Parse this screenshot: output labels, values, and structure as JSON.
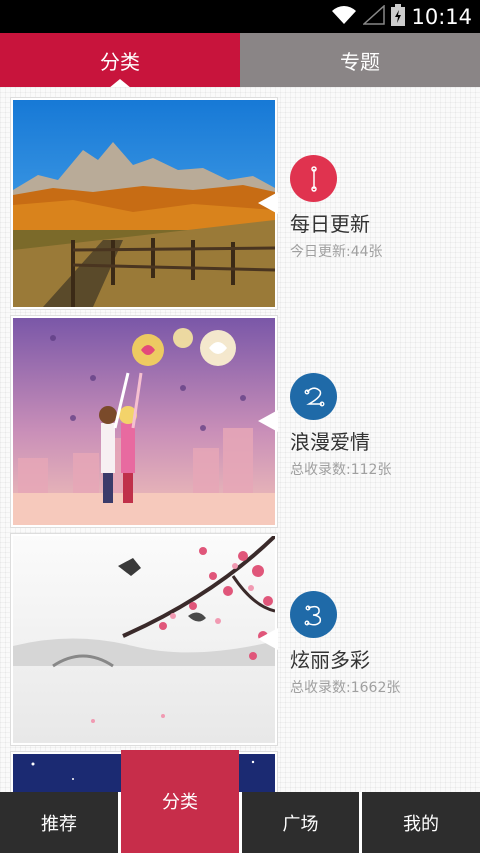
{
  "status_bar": {
    "time": "10:14"
  },
  "top_tabs": [
    {
      "label": "分类",
      "active": true
    },
    {
      "label": "专题",
      "active": false
    }
  ],
  "categories": [
    {
      "number": "1",
      "title": "每日更新",
      "subtitle": "今日更新:44张",
      "badge_color": "#e0334f"
    },
    {
      "number": "2",
      "title": "浪漫爱情",
      "subtitle": "总收录数:112张",
      "badge_color": "#1f6aa8"
    },
    {
      "number": "3",
      "title": "炫丽多彩",
      "subtitle": "总收录数:1662张",
      "badge_color": "#1f6aa8"
    }
  ],
  "bottom_nav": {
    "items": [
      {
        "label": "推荐"
      },
      {
        "label": "分类",
        "active": true
      },
      {
        "label": "广场"
      },
      {
        "label": "我的"
      }
    ]
  },
  "colors": {
    "accent": "#c8143c",
    "inactive_tab": "#8a8586",
    "nav_bg": "#2d2d2d",
    "badge_red": "#e0334f",
    "badge_blue": "#1f6aa8"
  }
}
